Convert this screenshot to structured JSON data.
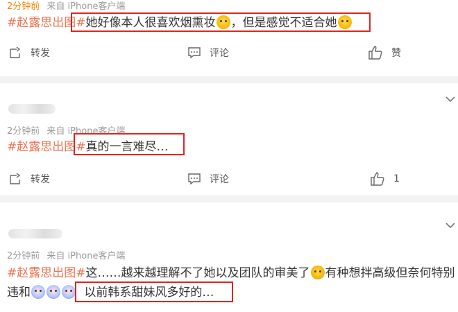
{
  "posts": [
    {
      "time": "2分钟前",
      "source": "来自 iPhone客户端",
      "tag": "#赵露思出图#",
      "text_before_emoji": "她好像本人很喜欢烟熏妆",
      "text_after_emoji": "，但是感觉不适合她",
      "actions": {
        "repost": "转发",
        "comment": "评论",
        "like": "赞"
      }
    },
    {
      "time": "2分钟前",
      "source": "来自 iPhone客户端",
      "tag": "#赵露思出图#",
      "text": "真的一言难尽…",
      "actions": {
        "repost": "转发",
        "comment": "评论",
        "like": "1"
      }
    },
    {
      "time": "2分钟前",
      "source": "来自 iPhone客户端",
      "tag": "#赵露思出图#",
      "line1_before_emoji": "这……越来越理解不了她以及团队的审美了",
      "line1_after_emoji": "有种想拌高级但奈何特别",
      "line2_start": "违和",
      "line2_highlight": "以前韩系甜妹风多好的…"
    }
  ],
  "icons": [
    "repost-icon",
    "comment-icon",
    "like-icon",
    "chevron-down-icon",
    "emoji-icon"
  ],
  "colors": {
    "tag": "#eb7350",
    "highlight_box": "#e0231f",
    "meta": "#999999",
    "separator": "#f2f2f2"
  }
}
